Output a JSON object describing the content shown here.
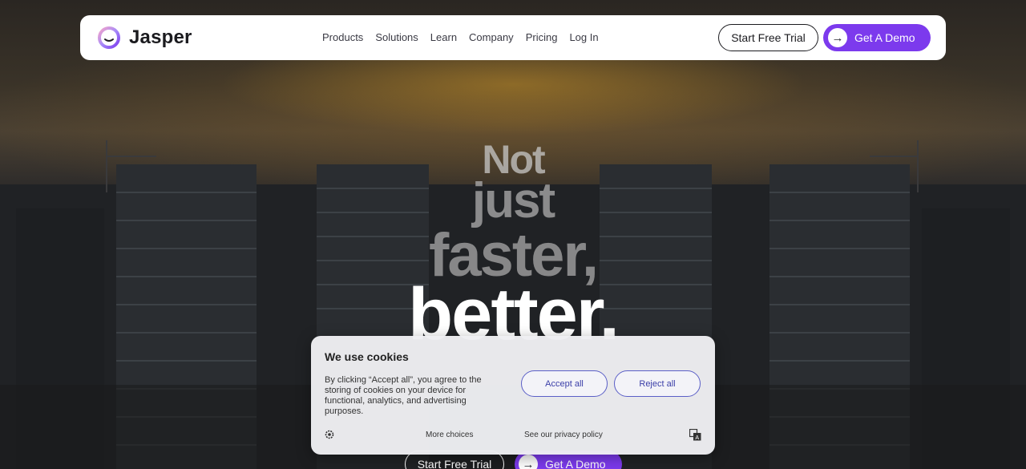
{
  "brand": {
    "name": "Jasper",
    "accent": "#7c3aed"
  },
  "nav": {
    "items": [
      "Products",
      "Solutions",
      "Learn",
      "Company",
      "Pricing",
      "Log In"
    ],
    "trial_label": "Start Free Trial",
    "demo_label": "Get A Demo"
  },
  "hero": {
    "line1": "Not",
    "line2": "just",
    "line3": "faster,",
    "line4": "better.",
    "trial_label": "Start Free Trial",
    "demo_label": "Get A Demo"
  },
  "cookie": {
    "title": "We use cookies",
    "body": "By clicking “Accept all”, you agree to the storing of cookies on your device for functional, analytics, and advertising purposes.",
    "accept_label": "Accept all",
    "reject_label": "Reject all",
    "more_label": "More choices",
    "privacy_label": "See our privacy policy"
  }
}
